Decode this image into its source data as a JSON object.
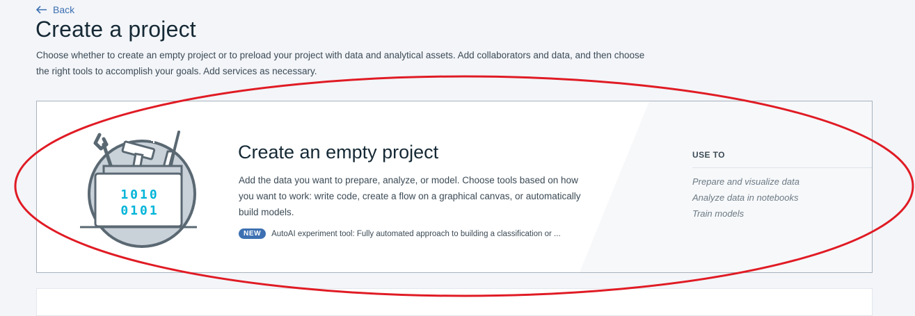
{
  "back": {
    "label": "Back",
    "icon": "arrow-left-icon"
  },
  "page": {
    "title": "Create a project",
    "description": "Choose whether to create an empty project or to preload your project with data and analytical assets. Add collaborators and data, and then choose the right tools to accomplish your goals. Add services as necessary."
  },
  "empty_project_card": {
    "title": "Create an empty project",
    "description": "Add the data you want to prepare, analyze, or model. Choose tools based on how you want to work: write code, create a flow on a graphical canvas, or automatically build models.",
    "badge": "NEW",
    "new_feature": "AutoAI experiment tool: Fully automated approach to building a classification or ...",
    "illustration": {
      "binary_line_1": "1010",
      "binary_line_2": "0101",
      "icon": "toolbox-icon"
    },
    "use_to": {
      "label": "USE TO",
      "items": [
        "Prepare and visualize data",
        "Analyze data in notebooks",
        "Train models"
      ]
    }
  },
  "colors": {
    "accent": "#3d70b2",
    "badge": "#3d70b2",
    "annotation": "#e01b24",
    "background": "#f3f5f9",
    "binary_digits": "#00b4d8"
  }
}
